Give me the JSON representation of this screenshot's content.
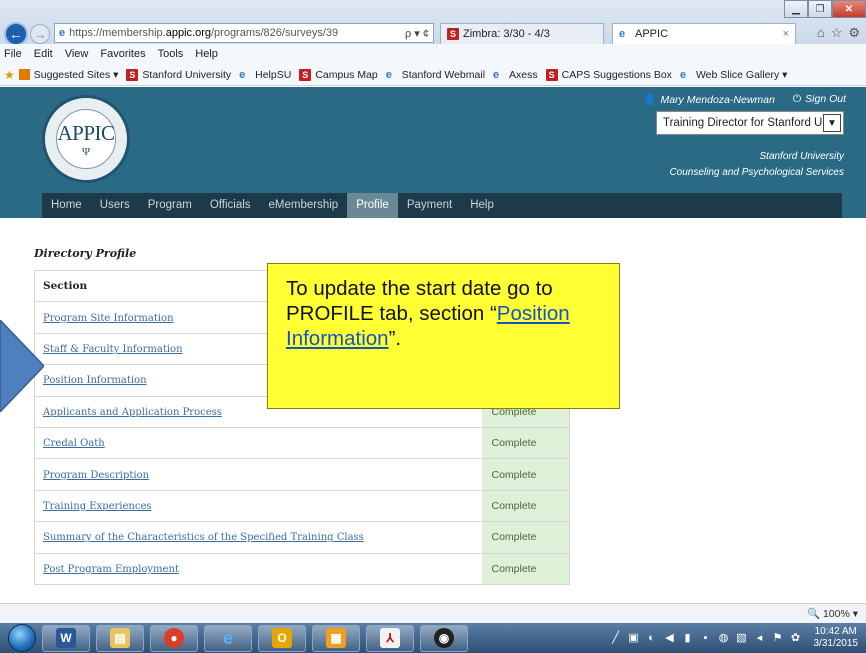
{
  "browser": {
    "url_prefix": "https://membership.",
    "url_domain": "appic.org",
    "url_path": "/programs/826/surveys/39",
    "address_controls": "ρ ▾ ¢",
    "tabs": [
      {
        "label": "Zimbra: 3/30 - 4/3"
      },
      {
        "label": "APPIC"
      }
    ],
    "menu": [
      "File",
      "Edit",
      "View",
      "Favorites",
      "Tools",
      "Help"
    ],
    "favorites": [
      {
        "label": "Suggested Sites ▾",
        "icon": "suggested-sites-icon"
      },
      {
        "label": "Stanford University",
        "icon": "stanford-icon"
      },
      {
        "label": "HelpSU",
        "icon": "ie-page-icon"
      },
      {
        "label": "Campus Map",
        "icon": "stanford-icon"
      },
      {
        "label": "Stanford Webmail",
        "icon": "ie-page-icon"
      },
      {
        "label": "Axess",
        "icon": "ie-page-icon"
      },
      {
        "label": "CAPS Suggestions Box",
        "icon": "stanford-icon"
      },
      {
        "label": "Web Slice Gallery ▾",
        "icon": "ie-page-icon"
      }
    ],
    "zoom": "100%"
  },
  "site": {
    "logo_text": "APPIC",
    "logo_ring_text": "ASSOCIATION OF PSYCHOLOGY POSTDOCTORAL AND INTERNSHIP CENTERS · SINCE 1968",
    "user_name": "Mary Mendoza-Newman",
    "sign_out": "Sign Out",
    "role_selected": "Training Director for Stanford Ui",
    "org_line1": "Stanford University",
    "org_line2": "Counseling and Psychological Services",
    "nav": [
      "Home",
      "Users",
      "Program",
      "Officials",
      "eMembership",
      "Profile",
      "Payment",
      "Help"
    ],
    "active_nav": "Profile"
  },
  "content": {
    "heading": "Directory Profile",
    "table_header": "Section",
    "rows": [
      {
        "section": "Program Site Information",
        "status": ""
      },
      {
        "section": "Staff & Faculty Information",
        "status": ""
      },
      {
        "section": "Position Information",
        "status": ""
      },
      {
        "section": "Applicants and Application Process",
        "status": "Complete"
      },
      {
        "section": "Credal Oath",
        "status": "Complete"
      },
      {
        "section": "Program Description",
        "status": "Complete"
      },
      {
        "section": "Training Experiences",
        "status": "Complete"
      },
      {
        "section": "Summary of the Characteristics of the Specified Training Class",
        "status": "Complete"
      },
      {
        "section": "Post Program Employment",
        "status": "Complete"
      }
    ]
  },
  "callout": {
    "text_before": "To update the start date go to PROFILE tab, section “",
    "link_text": "Position Information",
    "text_after": "”."
  },
  "taskbar": {
    "clock_time": "10:42 AM",
    "clock_date": "3/31/2015",
    "apps": [
      "Word",
      "File Explorer",
      "Chrome",
      "Internet Explorer",
      "Outlook",
      "Stanford App",
      "Adobe Reader",
      "Audio App"
    ]
  },
  "colors": {
    "header_bg": "#2a6a85",
    "nav_bg": "#1d3a4a",
    "nav_active": "#6a8995",
    "complete_bg": "#dff0d8",
    "callout_bg": "#ffff33",
    "link": "#3b6ca0"
  }
}
